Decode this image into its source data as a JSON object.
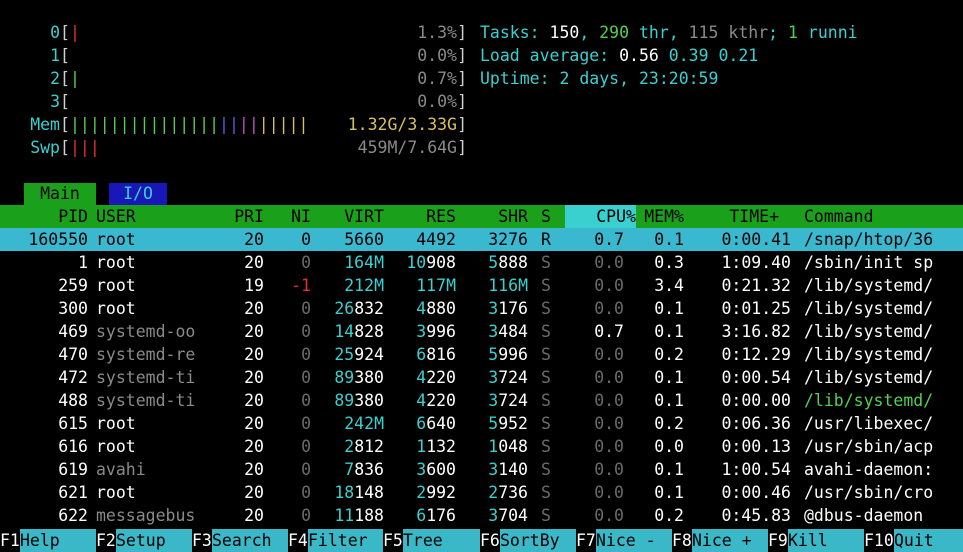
{
  "cpu_meters": [
    {
      "label": "0",
      "bars": "|",
      "bar_color": "#e23030",
      "value": "1.3%"
    },
    {
      "label": "1",
      "bars": "",
      "bar_color": "#52d052",
      "value": "0.0%"
    },
    {
      "label": "2",
      "bars": "|",
      "bar_color": "#52d052",
      "value": "0.7%"
    },
    {
      "label": "3",
      "bars": "",
      "bar_color": "#52d052",
      "value": "0.0%"
    }
  ],
  "mem_meter": {
    "label": "Mem",
    "bars_green": "|||||||||||||||",
    "bars_blue": "||",
    "bars_magenta": "||",
    "bars_yellow": "|||||",
    "value": "1.32G/3.33G"
  },
  "swp_meter": {
    "label": "Swp",
    "bars_red": "|||",
    "value": "459M/7.64G"
  },
  "summary": {
    "tasks_label": "Tasks: ",
    "tasks": "150",
    "thr": "290",
    "thr_label": " thr",
    "kthr": "115 kthr",
    "running": "1",
    "running_label": " runni",
    "load_label": "Load average: ",
    "load1": "0.56",
    "load5": "0.39",
    "load15": "0.21",
    "uptime_label": "Uptime: ",
    "uptime": "2 days, 23:20:59"
  },
  "tabs": {
    "main": "Main",
    "io": "I/O"
  },
  "columns": [
    "PID",
    "USER",
    "PRI",
    "NI",
    "VIRT",
    "RES",
    "SHR",
    "S",
    "CPU%",
    "MEM%",
    "TIME+",
    "Command"
  ],
  "processes": [
    {
      "pid": "160550",
      "user": "root",
      "pri": "20",
      "ni": "0",
      "virt": "5660",
      "res": "4492",
      "shr": "3276",
      "s": "R",
      "cpu": "0.7",
      "mem": "0.1",
      "time": "0:00.41",
      "cmd": "/snap/htop/36",
      "selected": true
    },
    {
      "pid": "1",
      "user": "root",
      "pri": "20",
      "ni": "0",
      "virt": "164M",
      "res": "10908",
      "shr": "5888",
      "s": "S",
      "cpu": "0.0",
      "mem": "0.3",
      "time": "1:09.40",
      "cmd": "/sbin/init sp"
    },
    {
      "pid": "259",
      "user": "root",
      "pri": "19",
      "ni": "-1",
      "virt": "212M",
      "res": "117M",
      "shr": "116M",
      "s": "S",
      "cpu": "0.0",
      "mem": "3.4",
      "time": "0:21.32",
      "cmd": "/lib/systemd/"
    },
    {
      "pid": "300",
      "user": "root",
      "pri": "20",
      "ni": "0",
      "virt": "26832",
      "res": "4880",
      "shr": "3176",
      "s": "S",
      "cpu": "0.0",
      "mem": "0.1",
      "time": "0:01.25",
      "cmd": "/lib/systemd/"
    },
    {
      "pid": "469",
      "user": "systemd-oo",
      "pri": "20",
      "ni": "0",
      "virt": "14828",
      "res": "3996",
      "shr": "3484",
      "s": "S",
      "cpu": "0.7",
      "mem": "0.1",
      "time": "3:16.82",
      "cmd": "/lib/systemd/"
    },
    {
      "pid": "470",
      "user": "systemd-re",
      "pri": "20",
      "ni": "0",
      "virt": "25924",
      "res": "6816",
      "shr": "5996",
      "s": "S",
      "cpu": "0.0",
      "mem": "0.2",
      "time": "0:12.29",
      "cmd": "/lib/systemd/"
    },
    {
      "pid": "472",
      "user": "systemd-ti",
      "pri": "20",
      "ni": "0",
      "virt": "89380",
      "res": "4220",
      "shr": "3724",
      "s": "S",
      "cpu": "0.0",
      "mem": "0.1",
      "time": "0:00.54",
      "cmd": "/lib/systemd/"
    },
    {
      "pid": "488",
      "user": "systemd-ti",
      "pri": "20",
      "ni": "0",
      "virt": "89380",
      "res": "4220",
      "shr": "3724",
      "s": "S",
      "cpu": "0.0",
      "mem": "0.1",
      "time": "0:00.00",
      "cmd": "/lib/systemd/",
      "cmd_thread": true
    },
    {
      "pid": "615",
      "user": "root",
      "pri": "20",
      "ni": "0",
      "virt": "242M",
      "res": "6640",
      "shr": "5952",
      "s": "S",
      "cpu": "0.0",
      "mem": "0.2",
      "time": "0:06.36",
      "cmd": "/usr/libexec/"
    },
    {
      "pid": "616",
      "user": "root",
      "pri": "20",
      "ni": "0",
      "virt": "2812",
      "res": "1132",
      "shr": "1048",
      "s": "S",
      "cpu": "0.0",
      "mem": "0.0",
      "time": "0:00.13",
      "cmd": "/usr/sbin/acp"
    },
    {
      "pid": "619",
      "user": "avahi",
      "pri": "20",
      "ni": "0",
      "virt": "7836",
      "res": "3600",
      "shr": "3140",
      "s": "S",
      "cpu": "0.0",
      "mem": "0.1",
      "time": "1:00.54",
      "cmd": "avahi-daemon:"
    },
    {
      "pid": "621",
      "user": "root",
      "pri": "20",
      "ni": "0",
      "virt": "18148",
      "res": "2992",
      "shr": "2736",
      "s": "S",
      "cpu": "0.0",
      "mem": "0.1",
      "time": "0:00.46",
      "cmd": "/usr/sbin/cro"
    },
    {
      "pid": "622",
      "user": "messagebus",
      "pri": "20",
      "ni": "0",
      "virt": "11188",
      "res": "6176",
      "shr": "3704",
      "s": "S",
      "cpu": "0.0",
      "mem": "0.2",
      "time": "0:45.83",
      "cmd": "@dbus-daemon"
    }
  ],
  "function_keys": [
    {
      "key": "F1",
      "label": "Help"
    },
    {
      "key": "F2",
      "label": "Setup"
    },
    {
      "key": "F3",
      "label": "Search"
    },
    {
      "key": "F4",
      "label": "Filter"
    },
    {
      "key": "F5",
      "label": "Tree"
    },
    {
      "key": "F6",
      "label": "SortBy"
    },
    {
      "key": "F7",
      "label": "Nice -"
    },
    {
      "key": "F8",
      "label": "Nice +"
    },
    {
      "key": "F9",
      "label": "Kill"
    },
    {
      "key": "F10",
      "label": "Quit"
    }
  ],
  "colors": {
    "cyan": "#3ad0d0",
    "green": "#1aa01a",
    "selection": "#3ab8d0",
    "tab_io": "#1818b8"
  }
}
